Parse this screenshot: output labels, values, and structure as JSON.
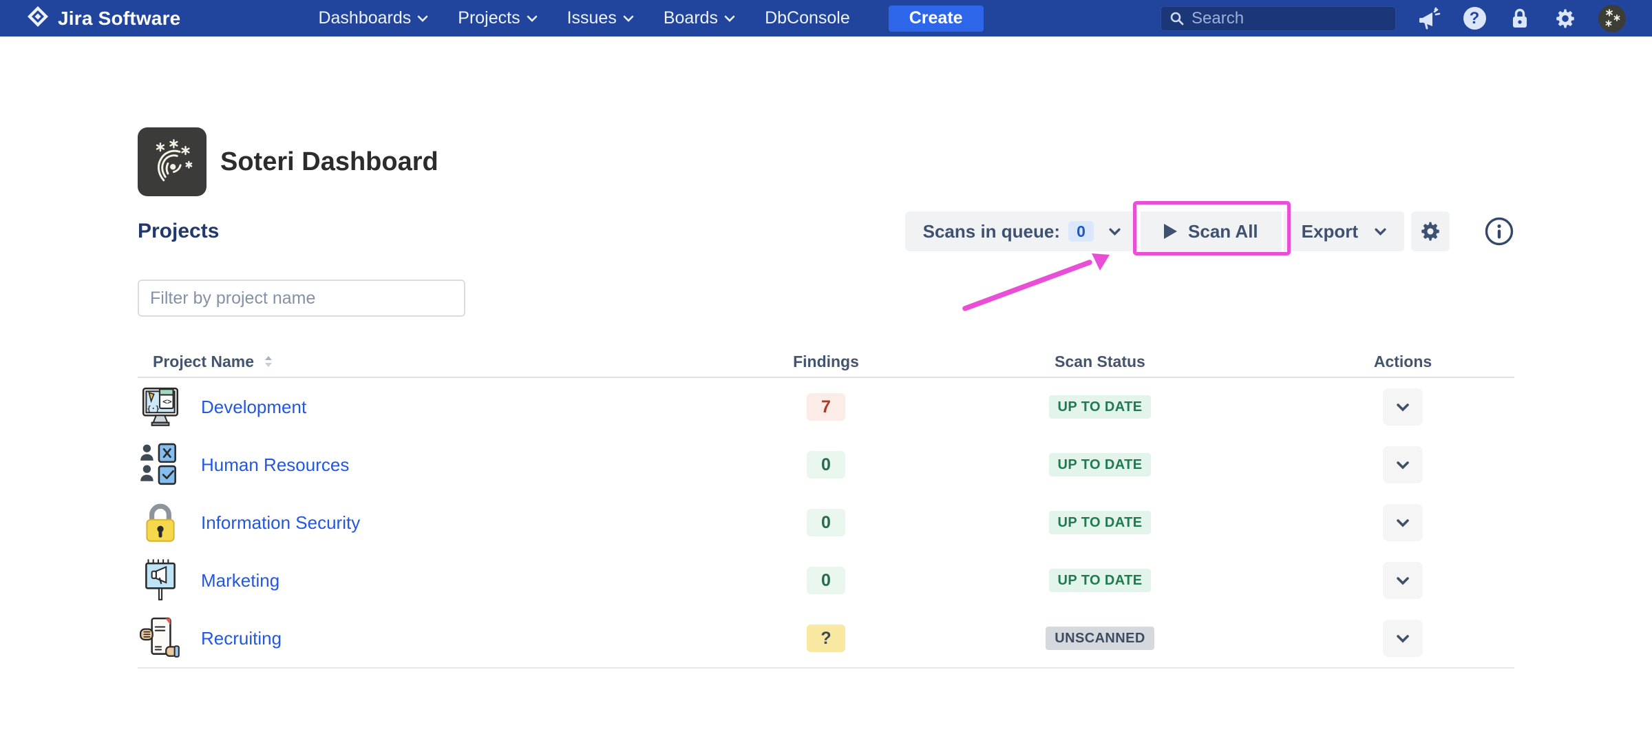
{
  "navbar": {
    "logo_text": "Jira Software",
    "items": [
      {
        "label": "Dashboards",
        "has_dropdown": true
      },
      {
        "label": "Projects",
        "has_dropdown": true
      },
      {
        "label": "Issues",
        "has_dropdown": true
      },
      {
        "label": "Boards",
        "has_dropdown": true
      },
      {
        "label": "DbConsole",
        "has_dropdown": false
      }
    ],
    "create_label": "Create",
    "search_placeholder": "Search",
    "right_icons": [
      "announcement-icon",
      "help-icon",
      "lock-icon",
      "gear-icon",
      "avatar"
    ]
  },
  "header": {
    "title": "Soteri Dashboard"
  },
  "projects": {
    "heading": "Projects",
    "filter_placeholder": "Filter by project name",
    "columns": [
      "Project Name",
      "Findings",
      "Scan Status",
      "Actions"
    ],
    "rows": [
      {
        "name": "Development",
        "icon": "development-project-icon",
        "findings": "7",
        "findings_type": "danger",
        "status": "UP TO DATE",
        "status_type": "success"
      },
      {
        "name": "Human Resources",
        "icon": "human-resources-project-icon",
        "findings": "0",
        "findings_type": "success",
        "status": "UP TO DATE",
        "status_type": "success"
      },
      {
        "name": "Information Security",
        "icon": "information-security-project-icon",
        "findings": "0",
        "findings_type": "success",
        "status": "UP TO DATE",
        "status_type": "success"
      },
      {
        "name": "Marketing",
        "icon": "marketing-project-icon",
        "findings": "0",
        "findings_type": "success",
        "status": "UP TO DATE",
        "status_type": "success"
      },
      {
        "name": "Recruiting",
        "icon": "recruiting-project-icon",
        "findings": "?",
        "findings_type": "warning",
        "status": "UNSCANNED",
        "status_type": "neutral"
      }
    ]
  },
  "toolbar": {
    "scans_in_queue_label": "Scans in queue:",
    "scans_in_queue_count": "0",
    "scan_all_label": "Scan All",
    "export_label": "Export"
  },
  "colors": {
    "navbar_bg": "#21459c",
    "create_button": "#2e66ea",
    "annotation_highlight": "#e94fd6",
    "project_link": "#2257e0",
    "findings_danger_bg": "#fcece7",
    "findings_danger_text": "#ae3a2a",
    "findings_success_bg": "#e9f7ef",
    "findings_warning_bg": "#f8e8a2",
    "status_success_bg": "#e3f5ea",
    "status_success_text": "#1f7a50",
    "status_neutral_bg": "#d5d8dd"
  }
}
